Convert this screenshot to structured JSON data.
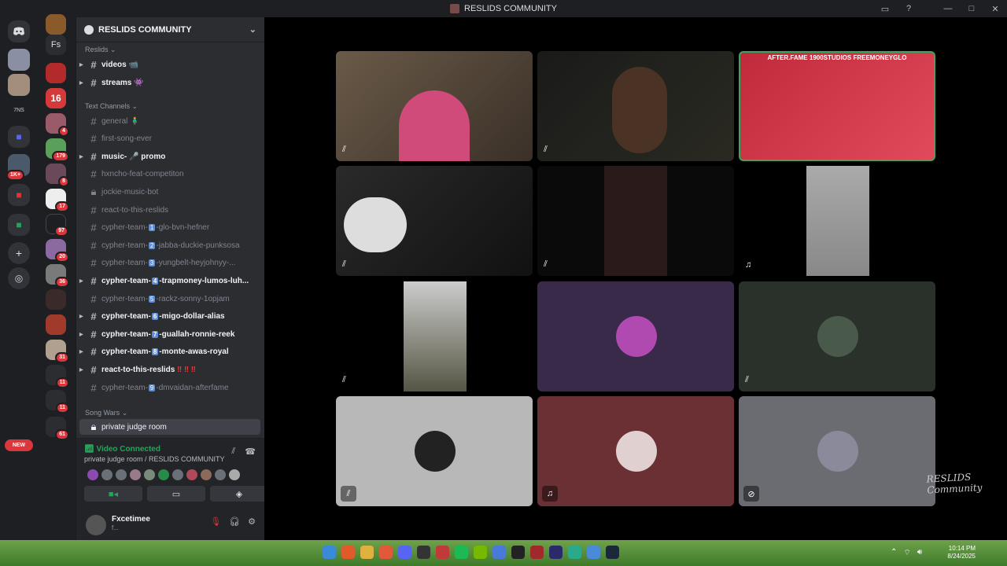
{
  "window": {
    "title": "RESLIDS COMMUNITY",
    "controls": {
      "minimize": "—",
      "maximize": "□",
      "close": "✕",
      "inbox": "▭",
      "help": "?"
    }
  },
  "server_rail": {
    "badges": [
      "4",
      "179",
      "8",
      "17",
      "97",
      "20",
      "36",
      "31",
      "11",
      "11",
      "61"
    ],
    "left_badge": "1K+",
    "new_label": "NEW",
    "fs_label": "Fs",
    "tile_label": "16"
  },
  "server": {
    "name": "RESLIDS COMMUNITY",
    "categories": {
      "reslids": "Reslids",
      "text": "Text Channels",
      "song_wars": "Song Wars"
    },
    "reslids_channels": [
      {
        "name": "videos 📹",
        "bold": true
      },
      {
        "name": "streams 👾",
        "bold": true
      }
    ],
    "text_channels": [
      {
        "pre": "general 🧍‍♂️",
        "num": "",
        "post": "",
        "bold": false,
        "caret": false,
        "lock": false
      },
      {
        "pre": "first-song-ever",
        "num": "",
        "post": "",
        "bold": false,
        "caret": false,
        "lock": false
      },
      {
        "pre": "music- 🎤 promo",
        "num": "",
        "post": "",
        "bold": true,
        "caret": true,
        "lock": false
      },
      {
        "pre": "hxncho-feat-competiton",
        "num": "",
        "post": "",
        "bold": false,
        "caret": false,
        "lock": false
      },
      {
        "pre": "jockie-music-bot",
        "num": "",
        "post": "",
        "bold": false,
        "caret": false,
        "lock": true
      },
      {
        "pre": "react-to-this-reslids",
        "num": "",
        "post": "",
        "bold": false,
        "caret": false,
        "lock": false
      },
      {
        "pre": "cypher-team-",
        "num": "1",
        "post": "-glo-bvn-hefner",
        "bold": false,
        "caret": false,
        "lock": false
      },
      {
        "pre": "cypher-team-",
        "num": "2",
        "post": "-jabba-duckie-punksosa",
        "bold": false,
        "caret": false,
        "lock": false
      },
      {
        "pre": "cypher-team-",
        "num": "3",
        "post": "-yungbelt-heyjohnyy-...",
        "bold": false,
        "caret": false,
        "lock": false
      },
      {
        "pre": "cypher-team-",
        "num": "4",
        "post": "-trapmoney-lumos-luh...",
        "bold": true,
        "caret": true,
        "lock": false
      },
      {
        "pre": "cypher-team-",
        "num": "5",
        "post": "-rackz-sonny-1opjam",
        "bold": false,
        "caret": false,
        "lock": false
      },
      {
        "pre": "cypher-team-",
        "num": "6",
        "post": "-migo-dollar-alias",
        "bold": true,
        "caret": true,
        "lock": false
      },
      {
        "pre": "cypher-team-",
        "num": "7",
        "post": "-guallah-ronnie-reek",
        "bold": true,
        "caret": true,
        "lock": false
      },
      {
        "pre": "cypher-team-",
        "num": "8",
        "post": "-monte-awas-royal",
        "bold": true,
        "caret": true,
        "lock": false
      },
      {
        "pre": "react-to-this-reslids",
        "num": "",
        "post": " ‼ ‼ ‼",
        "bold": true,
        "caret": true,
        "lock": false
      },
      {
        "pre": "cypher-team-",
        "num": "9",
        "post": "-dmvaidan-afterfame",
        "bold": false,
        "caret": false,
        "lock": false
      }
    ],
    "song_wars_channels": [
      {
        "name": "private judge room",
        "selected": true
      }
    ]
  },
  "voice_panel": {
    "status": "Video Connected",
    "location": "private judge room / RESLIDS COMMUNITY"
  },
  "user_panel": {
    "name": "Fxcetimee",
    "status": "f..."
  },
  "video_tiles": {
    "overlay_text": "AFTER.FAME   1900STUDIOS   FREEMONEYGLO"
  },
  "watermark": "RESLIDS Community",
  "taskbar": {
    "time": "10:14 PM",
    "date": "8/24/2025"
  },
  "colors": {
    "accent_green": "#23a559",
    "badge_red": "#da373c",
    "sidebar_bg": "#2b2d31",
    "rail_bg": "#1e1f22"
  }
}
